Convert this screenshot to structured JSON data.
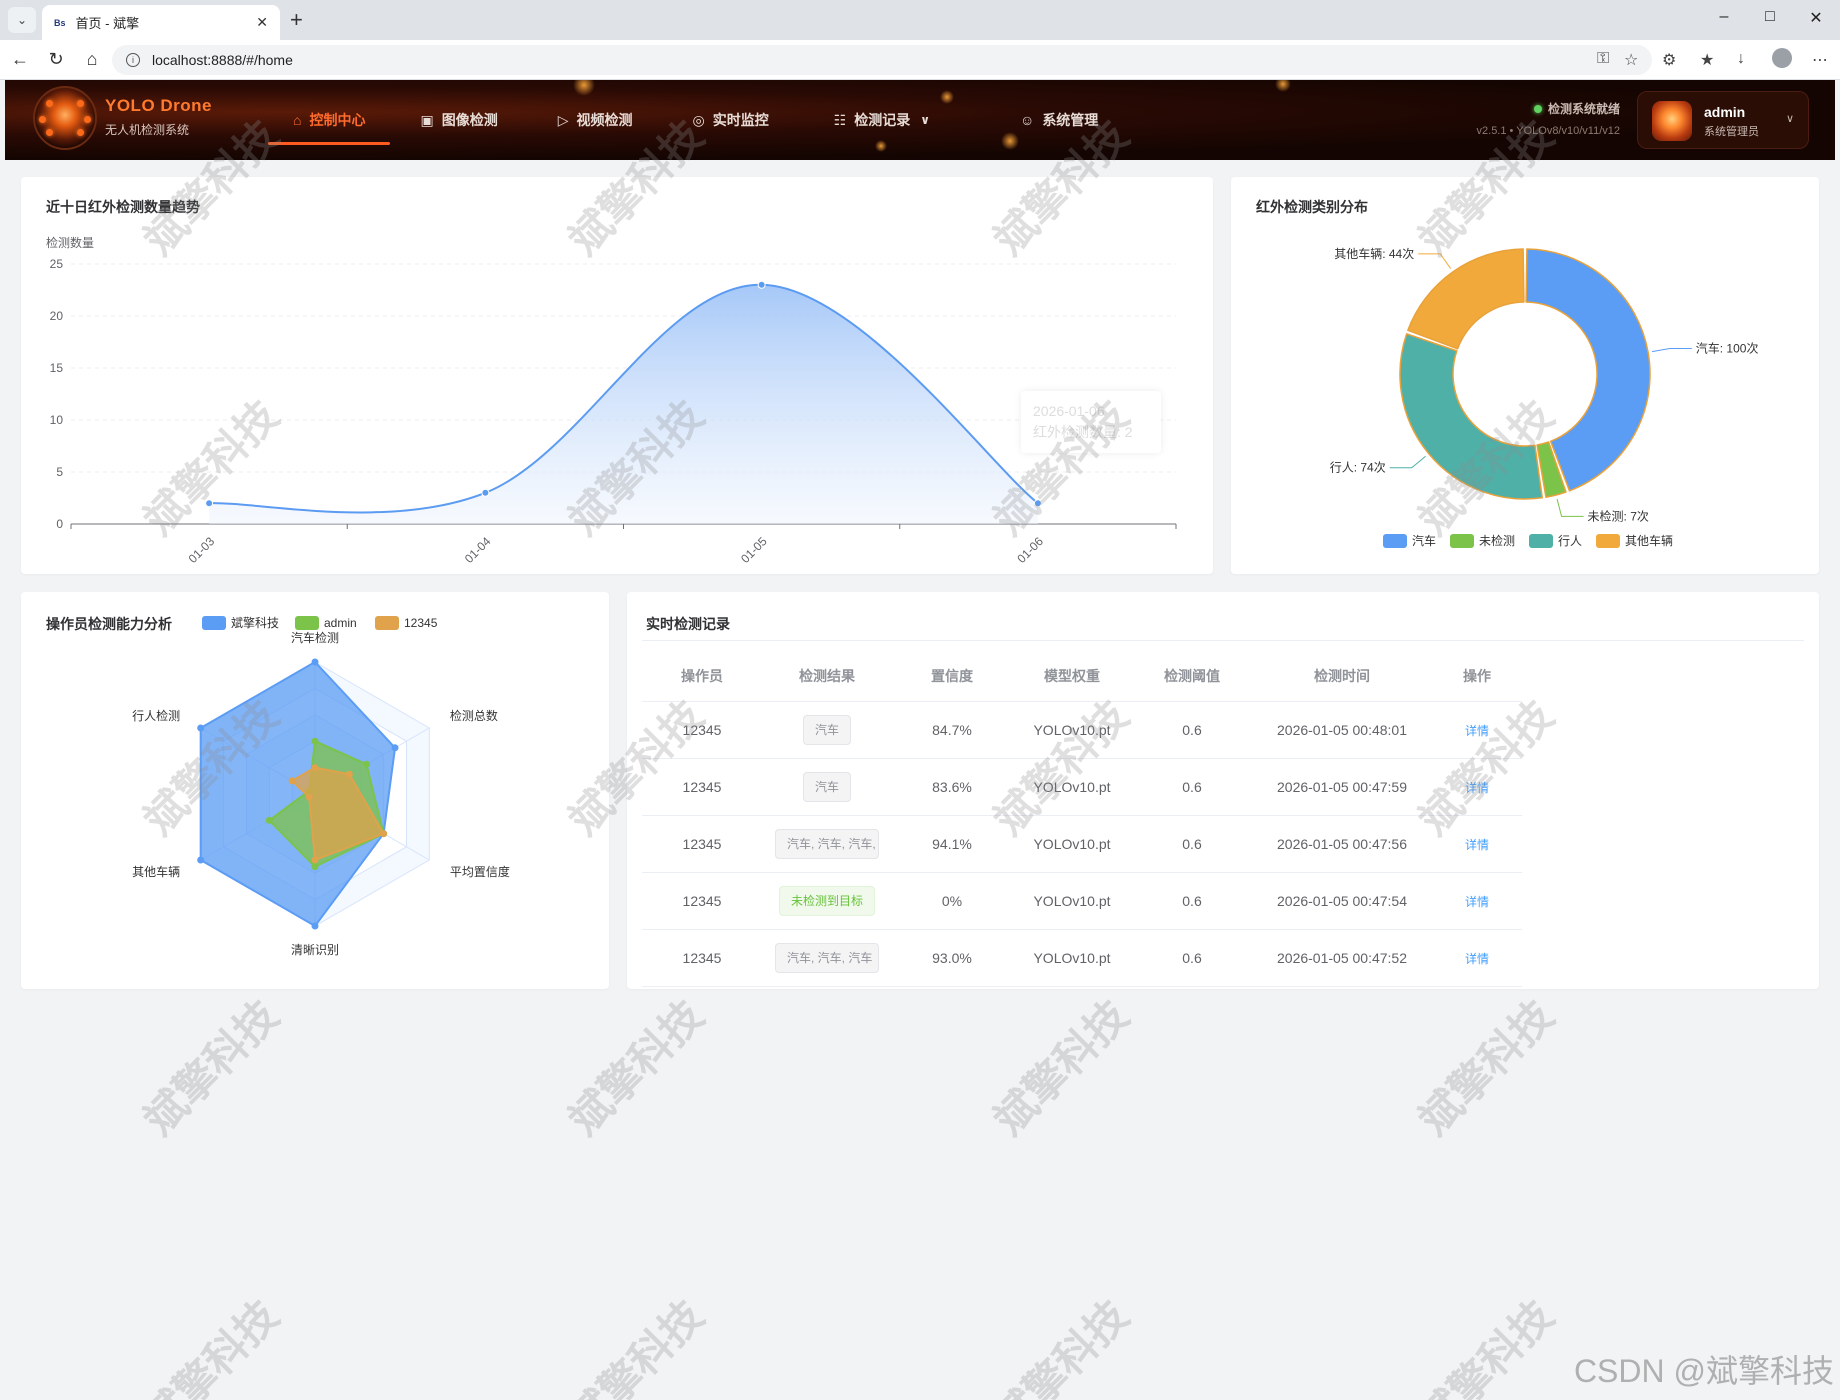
{
  "browser": {
    "tab_icon": "Bs",
    "tab_title": "首页 - 斌擎",
    "url": "localhost:8888/#/home"
  },
  "header": {
    "brand_name": "YOLO Drone",
    "brand_sub": "无人机检测系统",
    "menu": [
      {
        "label": "控制中心",
        "icon": "home-icon",
        "active": true
      },
      {
        "label": "图像检测",
        "icon": "image-icon"
      },
      {
        "label": "视频检测",
        "icon": "play-circle-icon"
      },
      {
        "label": "实时监控",
        "icon": "camera-icon"
      },
      {
        "label": "检测记录",
        "icon": "document-icon",
        "dropdown": true
      },
      {
        "label": "系统管理",
        "icon": "user-icon"
      }
    ],
    "status_text": "检测系统就绪",
    "version_text": "v2.5.1 • YOLOv8/v10/v11/v12",
    "user_name": "admin",
    "user_role": "系统管理员"
  },
  "trend_card": {
    "title": "近十日红外检测数量趋势",
    "tooltip_date": "2026-01-06",
    "tooltip_value": "红外检测数量: 2"
  },
  "pie_card": {
    "title": "红外检测类别分布"
  },
  "radar_card": {
    "title": "操作员检测能力分析"
  },
  "records_card": {
    "title": "实时检测记录",
    "columns": [
      "操作员",
      "检测结果",
      "置信度",
      "模型权重",
      "检测阈值",
      "检测时间",
      "操作"
    ],
    "rows": [
      {
        "operator": "12345",
        "result": "汽车",
        "result_type": "gray",
        "confidence": "84.7%",
        "model": "YOLOv10.pt",
        "threshold": "0.6",
        "time": "2026-01-05 00:48:01",
        "action": "详情"
      },
      {
        "operator": "12345",
        "result": "汽车",
        "result_type": "gray",
        "confidence": "83.6%",
        "model": "YOLOv10.pt",
        "threshold": "0.6",
        "time": "2026-01-05 00:47:59",
        "action": "详情"
      },
      {
        "operator": "12345",
        "result": "汽车, 汽车, 汽车,",
        "result_type": "gray",
        "confidence": "94.1%",
        "model": "YOLOv10.pt",
        "threshold": "0.6",
        "time": "2026-01-05 00:47:56",
        "action": "详情"
      },
      {
        "operator": "12345",
        "result": "未检测到目标",
        "result_type": "green",
        "confidence": "0%",
        "model": "YOLOv10.pt",
        "threshold": "0.6",
        "time": "2026-01-05 00:47:54",
        "action": "详情"
      },
      {
        "operator": "12345",
        "result": "汽车, 汽车, 汽车",
        "result_type": "gray",
        "confidence": "93.0%",
        "model": "YOLOv10.pt",
        "threshold": "0.6",
        "time": "2026-01-05 00:47:52",
        "action": "详情"
      }
    ]
  },
  "watermark": "斌擎科技",
  "csdn_mark": "CSDN @斌擎科技",
  "chart_data": [
    {
      "type": "area",
      "title": "近十日红外检测数量趋势",
      "ylabel": "检测数量",
      "categories": [
        "01-03",
        "01-04",
        "01-05",
        "01-06"
      ],
      "series": [
        {
          "name": "红外检测数量",
          "values": [
            2,
            3,
            23,
            2
          ]
        }
      ],
      "ylim": [
        0,
        25
      ],
      "yticks": [
        0,
        5,
        10,
        15,
        20,
        25
      ],
      "color": "#5b9bf2"
    },
    {
      "type": "pie",
      "title": "红外检测类别分布",
      "donut": true,
      "slices": [
        {
          "name": "汽车",
          "value": 100,
          "label": "汽车: 100次",
          "color": "#5b9cf4"
        },
        {
          "name": "未检测",
          "value": 7,
          "label": "未检测: 7次",
          "color": "#7cc34a"
        },
        {
          "name": "行人",
          "value": 74,
          "label": "行人: 74次",
          "color": "#4fb0a8"
        },
        {
          "name": "其他车辆",
          "value": 44,
          "label": "其他车辆: 44次",
          "color": "#f2a93b"
        }
      ],
      "legend_position": "bottom"
    },
    {
      "type": "radar",
      "title": "操作员检测能力分析",
      "indicators": [
        "汽车检测",
        "检测总数",
        "平均置信度",
        "清晰识别",
        "其他车辆",
        "行人检测"
      ],
      "max": 100,
      "series": [
        {
          "name": "斌擎科技",
          "values": [
            100,
            70,
            60,
            100,
            100,
            100
          ],
          "color": "#5b9cf4"
        },
        {
          "name": "admin",
          "values": [
            40,
            45,
            60,
            55,
            40,
            5
          ],
          "color": "#7cc34a"
        },
        {
          "name": "12345",
          "values": [
            20,
            30,
            60,
            50,
            5,
            20
          ],
          "color": "#e0a24a"
        }
      ],
      "legend_position": "top"
    }
  ]
}
